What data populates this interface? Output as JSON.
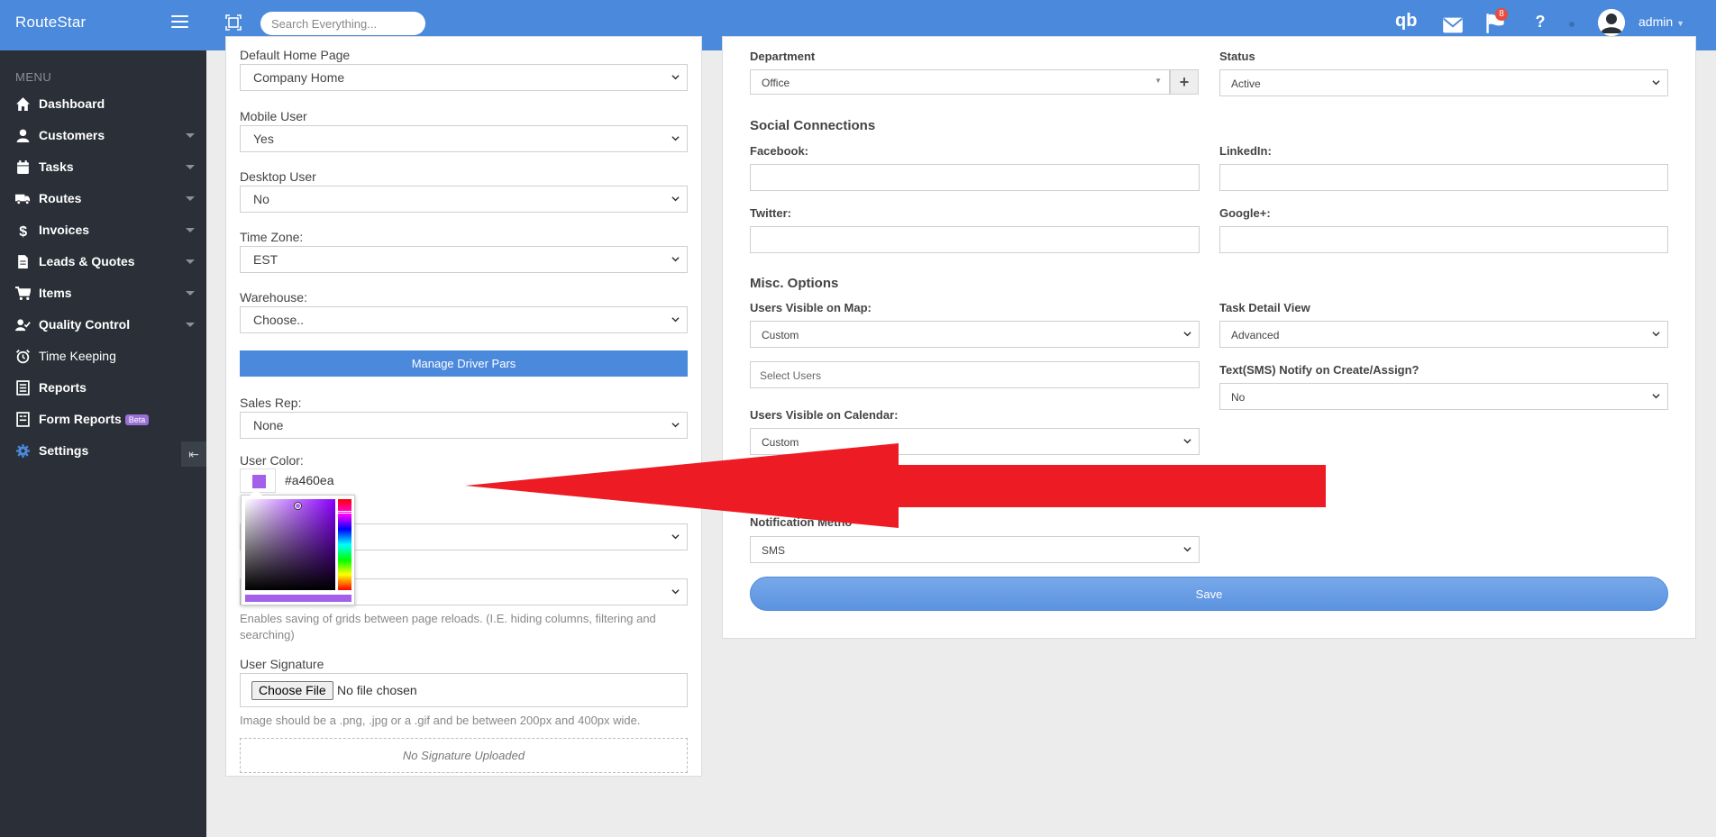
{
  "app": {
    "brand": "RouteStar"
  },
  "topbar": {
    "search_placeholder": "Search Everything...",
    "notification_count": "8",
    "user_name": "admin"
  },
  "sidebar": {
    "menu_title": "MENU",
    "items": [
      {
        "label": "Dashboard",
        "icon": "home-icon",
        "has_submenu": false
      },
      {
        "label": "Customers",
        "icon": "user-icon",
        "has_submenu": true
      },
      {
        "label": "Tasks",
        "icon": "calendar-icon",
        "has_submenu": true
      },
      {
        "label": "Routes",
        "icon": "truck-icon",
        "has_submenu": true
      },
      {
        "label": "Invoices",
        "icon": "dollar-icon",
        "has_submenu": true
      },
      {
        "label": "Leads & Quotes",
        "icon": "document-icon",
        "has_submenu": true
      },
      {
        "label": "Items",
        "icon": "cart-icon",
        "has_submenu": true
      },
      {
        "label": "Quality Control",
        "icon": "user-check-icon",
        "has_submenu": true
      },
      {
        "label": "Time Keeping",
        "icon": "alarm-clock-icon",
        "has_submenu": false
      },
      {
        "label": "Reports",
        "icon": "list-icon",
        "has_submenu": false
      },
      {
        "label": "Form Reports",
        "icon": "form-icon",
        "has_submenu": false,
        "badge": "Beta"
      },
      {
        "label": "Settings",
        "icon": "gear-icon",
        "has_submenu": true
      }
    ]
  },
  "left_form": {
    "default_home_page": {
      "label": "Default Home Page",
      "value": "Company Home"
    },
    "mobile_user": {
      "label": "Mobile User",
      "value": "Yes"
    },
    "desktop_user": {
      "label": "Desktop User",
      "value": "No"
    },
    "time_zone": {
      "label": "Time Zone:",
      "value": "EST"
    },
    "warehouse": {
      "label": "Warehouse:",
      "value": "Choose.."
    },
    "manage_driver_pars": "Manage Driver Pars",
    "sales_rep": {
      "label": "Sales Rep:",
      "value": "None"
    },
    "user_color": {
      "label": "User Color:",
      "value": "#a460ea"
    },
    "grid_help": "Enables saving of grids between page reloads. (I.E. hiding columns, filtering and searching)",
    "user_signature": {
      "label": "User Signature",
      "choose_button": "Choose File",
      "file_status": "No file chosen",
      "help": "Image should be a .png, .jpg or a .gif and be between 200px and 400px wide.",
      "empty_text": "No Signature Uploaded"
    }
  },
  "right_form": {
    "department": {
      "label": "Department",
      "value": "Office",
      "add_label": "+"
    },
    "status": {
      "label": "Status",
      "value": "Active"
    },
    "social_title": "Social Connections",
    "facebook": {
      "label": "Facebook:",
      "value": ""
    },
    "linkedin": {
      "label": "LinkedIn:",
      "value": ""
    },
    "twitter": {
      "label": "Twitter:",
      "value": ""
    },
    "googleplus": {
      "label": "Google+:",
      "value": ""
    },
    "misc_title": "Misc. Options",
    "users_visible_map": {
      "label": "Users Visible on Map:",
      "value": "Custom"
    },
    "select_users": {
      "placeholder": "Select Users"
    },
    "task_detail_view": {
      "label": "Task Detail View",
      "value": "Advanced"
    },
    "sms_notify": {
      "label": "Text(SMS) Notify on Create/Assign?",
      "value": "No"
    },
    "users_visible_calendar": {
      "label": "Users Visible on Calendar:",
      "value": "Custom"
    },
    "notification_method": {
      "label": "Notification Metho",
      "value": "SMS"
    },
    "save_button": "Save"
  },
  "colors": {
    "topbar": "#4b89dc",
    "sidebar": "#2b3038",
    "user_color": "#a460ea",
    "annotation_arrow": "#ed1c24"
  }
}
